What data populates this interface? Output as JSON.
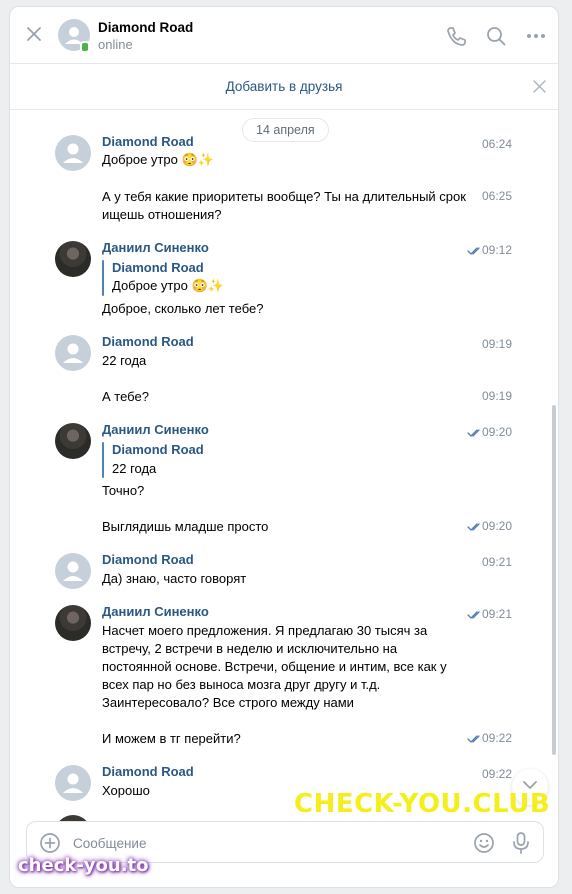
{
  "header": {
    "contact_name": "Diamond Road",
    "status": "online"
  },
  "friend_bar": {
    "label": "Добавить в друзья"
  },
  "date_separator": "14 апреля",
  "messages": [
    {
      "author": "Diamond Road",
      "text": "Доброе утро 😳✨",
      "time": "06:24"
    },
    {
      "text": "А у тебя какие приоритеты вообще? Ты на длительный срок",
      "text2": "ищешь отношения?",
      "time": "06:25"
    },
    {
      "author": "Даниил Синенко",
      "reply_author": "Diamond Road",
      "reply_text": "Доброе утро 😳✨",
      "text": "Доброе, сколько лет тебе?",
      "time": "09:12"
    },
    {
      "author": "Diamond Road",
      "text": "22 года",
      "time": "09:19"
    },
    {
      "text": "А тебе?",
      "time": "09:19"
    },
    {
      "author": "Даниил Синенко",
      "reply_author": "Diamond Road",
      "reply_text": "22 года",
      "text": "Точно?",
      "time": "09:20"
    },
    {
      "text": "Выглядишь младше просто",
      "time": "09:20"
    },
    {
      "author": "Diamond Road",
      "text": "Да) знаю, часто говорят",
      "time": "09:21"
    },
    {
      "author": "Даниил Синенко",
      "line1": "Насчет моего предложения. Я предлагаю 30 тысяч за",
      "line2": "встречу, 2 встречи в неделю и исключительно на",
      "line3": "постоянной основе. Встречи, общение и интим, все как у",
      "line4": "всех пар но без выноса мозга друг другу и т.д.",
      "line5": "Заинтересовало? Все строго между нами",
      "time": "09:21"
    },
    {
      "text": "И можем в тг перейти?",
      "time": "09:22"
    },
    {
      "author": "Diamond Road",
      "text": "Хорошо",
      "time": "09:22"
    }
  ],
  "composer": {
    "placeholder": "Сообщение"
  },
  "watermarks": {
    "main": "CHECK-YOU.CLUB",
    "corner": "check-you.to"
  },
  "colors": {
    "link": "#2a5885",
    "accent": "#5181b8",
    "online": "#4bb34b",
    "watermark": "#f4ef1c"
  }
}
